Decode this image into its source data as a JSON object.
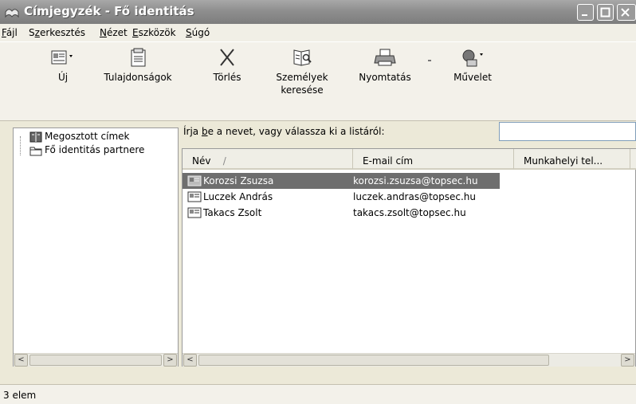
{
  "window": {
    "title": "Címjegyzék - Fő identitás"
  },
  "menu": {
    "items": [
      {
        "pre": "",
        "key": "F",
        "post": "ájl"
      },
      {
        "pre": "S",
        "key": "z",
        "post": "erkesztés"
      },
      {
        "pre": "",
        "key": "N",
        "post": "ézet"
      },
      {
        "pre": "",
        "key": "E",
        "post": "szközök"
      },
      {
        "pre": "",
        "key": "S",
        "post": "úgó"
      }
    ]
  },
  "toolbar": {
    "new_label": "Új",
    "properties_label": "Tulajdonságok",
    "delete_label": "Törlés",
    "find_line1": "Személyek",
    "find_line2": "keresése",
    "print_label": "Nyomtatás",
    "action_label": "Művelet"
  },
  "tree": {
    "items": [
      {
        "label": "Megosztott címek"
      },
      {
        "label": "Fő identitás partnere"
      }
    ]
  },
  "search": {
    "prompt_pre": "Írja ",
    "prompt_key": "b",
    "prompt_post": "e a nevet, vagy válassza ki a listáról:",
    "value": ""
  },
  "table": {
    "columns": [
      "Név",
      "E-mail cím",
      "Munkahelyi tel..."
    ],
    "sort_indicator": "/",
    "rows": [
      {
        "name": "Korozsi Zsuzsa",
        "email": "korozsi.zsuzsa@topsec.hu",
        "selected": true
      },
      {
        "name": "Luczek András",
        "email": "luczek.andras@topsec.hu",
        "selected": false
      },
      {
        "name": "Takacs Zsolt",
        "email": "takacs.zsolt@topsec.hu",
        "selected": false
      }
    ]
  },
  "status": {
    "text": "3 elem"
  },
  "icons": {
    "title": "address-book-icon",
    "new": "new-contact-icon",
    "properties": "properties-icon",
    "delete": "delete-x-icon",
    "find": "find-people-icon",
    "print": "printer-icon",
    "action": "action-icon",
    "contact": "contact-card-icon",
    "folder": "folder-icon",
    "shared": "shared-book-icon"
  },
  "colors": {
    "titlebar": "#8e8e8e",
    "selection": "#6e6e6e",
    "window_bg": "#ece9d8"
  }
}
